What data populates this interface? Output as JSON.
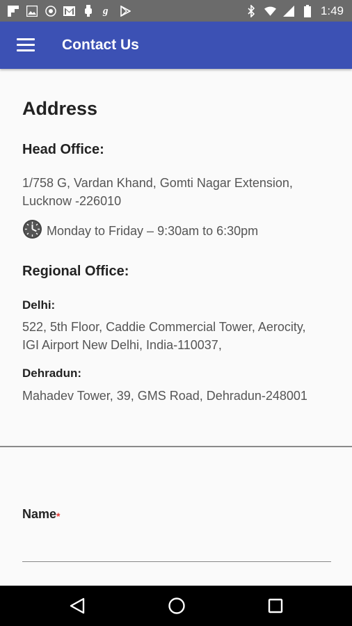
{
  "status_bar": {
    "time": "1:49",
    "left_icons": [
      "flipboard-icon",
      "image-icon",
      "vpn-icon",
      "gmail-icon",
      "usb-icon",
      "g-icon",
      "play-store-icon"
    ],
    "right_icons": [
      "bluetooth-icon",
      "wifi-icon",
      "signal-icon",
      "battery-icon"
    ]
  },
  "app_bar": {
    "title": "Contact Us",
    "color": "#3c51b4"
  },
  "address": {
    "heading": "Address",
    "head_office": {
      "label": "Head Office:",
      "line1": "1/758 G, Vardan Khand, Gomti Nagar Extension,",
      "line2": "Lucknow -226010",
      "hours": "Monday to Friday – 9:30am to 6:30pm"
    },
    "regional": {
      "label": "Regional Office:",
      "delhi": {
        "city": "Delhi:",
        "line1": "522, 5th Floor, Caddie Commercial Tower, Aerocity,",
        "line2": "IGI Airport New Delhi, India-110037,"
      },
      "dehradun": {
        "city": "Dehradun:",
        "line1": "Mahadev Tower, 39, GMS Road, Dehradun-248001"
      }
    }
  },
  "form": {
    "name_label": "Name",
    "required_mark": "*",
    "name_value": ""
  },
  "nav_bar": {
    "buttons": [
      "back-icon",
      "home-icon",
      "recents-icon"
    ]
  }
}
